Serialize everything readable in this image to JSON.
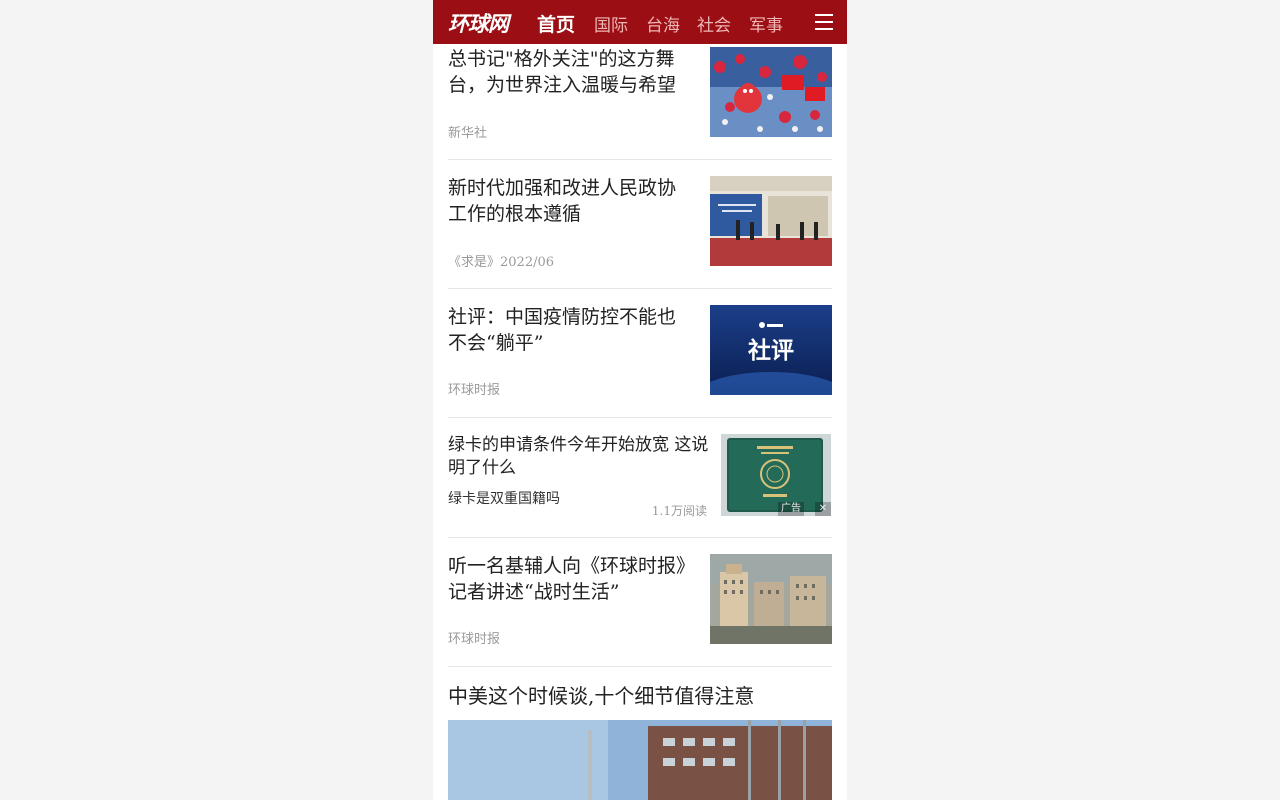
{
  "header": {
    "logo": "环球网",
    "tabs": [
      {
        "label": "首页",
        "active": true
      },
      {
        "label": "国际",
        "active": false
      },
      {
        "label": "台海",
        "active": false
      },
      {
        "label": "社会",
        "active": false
      },
      {
        "label": "军事",
        "active": false
      }
    ],
    "menu_icon": "hamburger-menu-icon"
  },
  "articles": [
    {
      "title": "总书记\"格外关注\"的这方舞台，为世界注入温暖与希望",
      "source": "新华社"
    },
    {
      "title": "新时代加强和改进人民政协工作的根本遵循",
      "source": "《求是》2022/06"
    },
    {
      "title": "社评：中国疫情防控不能也不会“躺平”",
      "source": "环球时报",
      "thumb_text": "社评"
    },
    {
      "title": "听一名基辅人向《环球时报》记者讲述“战时生活”",
      "source": "环球时报"
    }
  ],
  "ad": {
    "title": "绿卡的申请条件今年开始放宽 这说明了什么",
    "subtitle": "绿卡是双重国籍吗",
    "reads": "1.1万阅读",
    "ad_label": "广告",
    "close_icon": "close-icon"
  },
  "big_article": {
    "title": "中美这个时候谈,十个细节值得注意"
  },
  "colors": {
    "brand_red": "#9b0e13",
    "page_bg": "#f4f4f4"
  }
}
